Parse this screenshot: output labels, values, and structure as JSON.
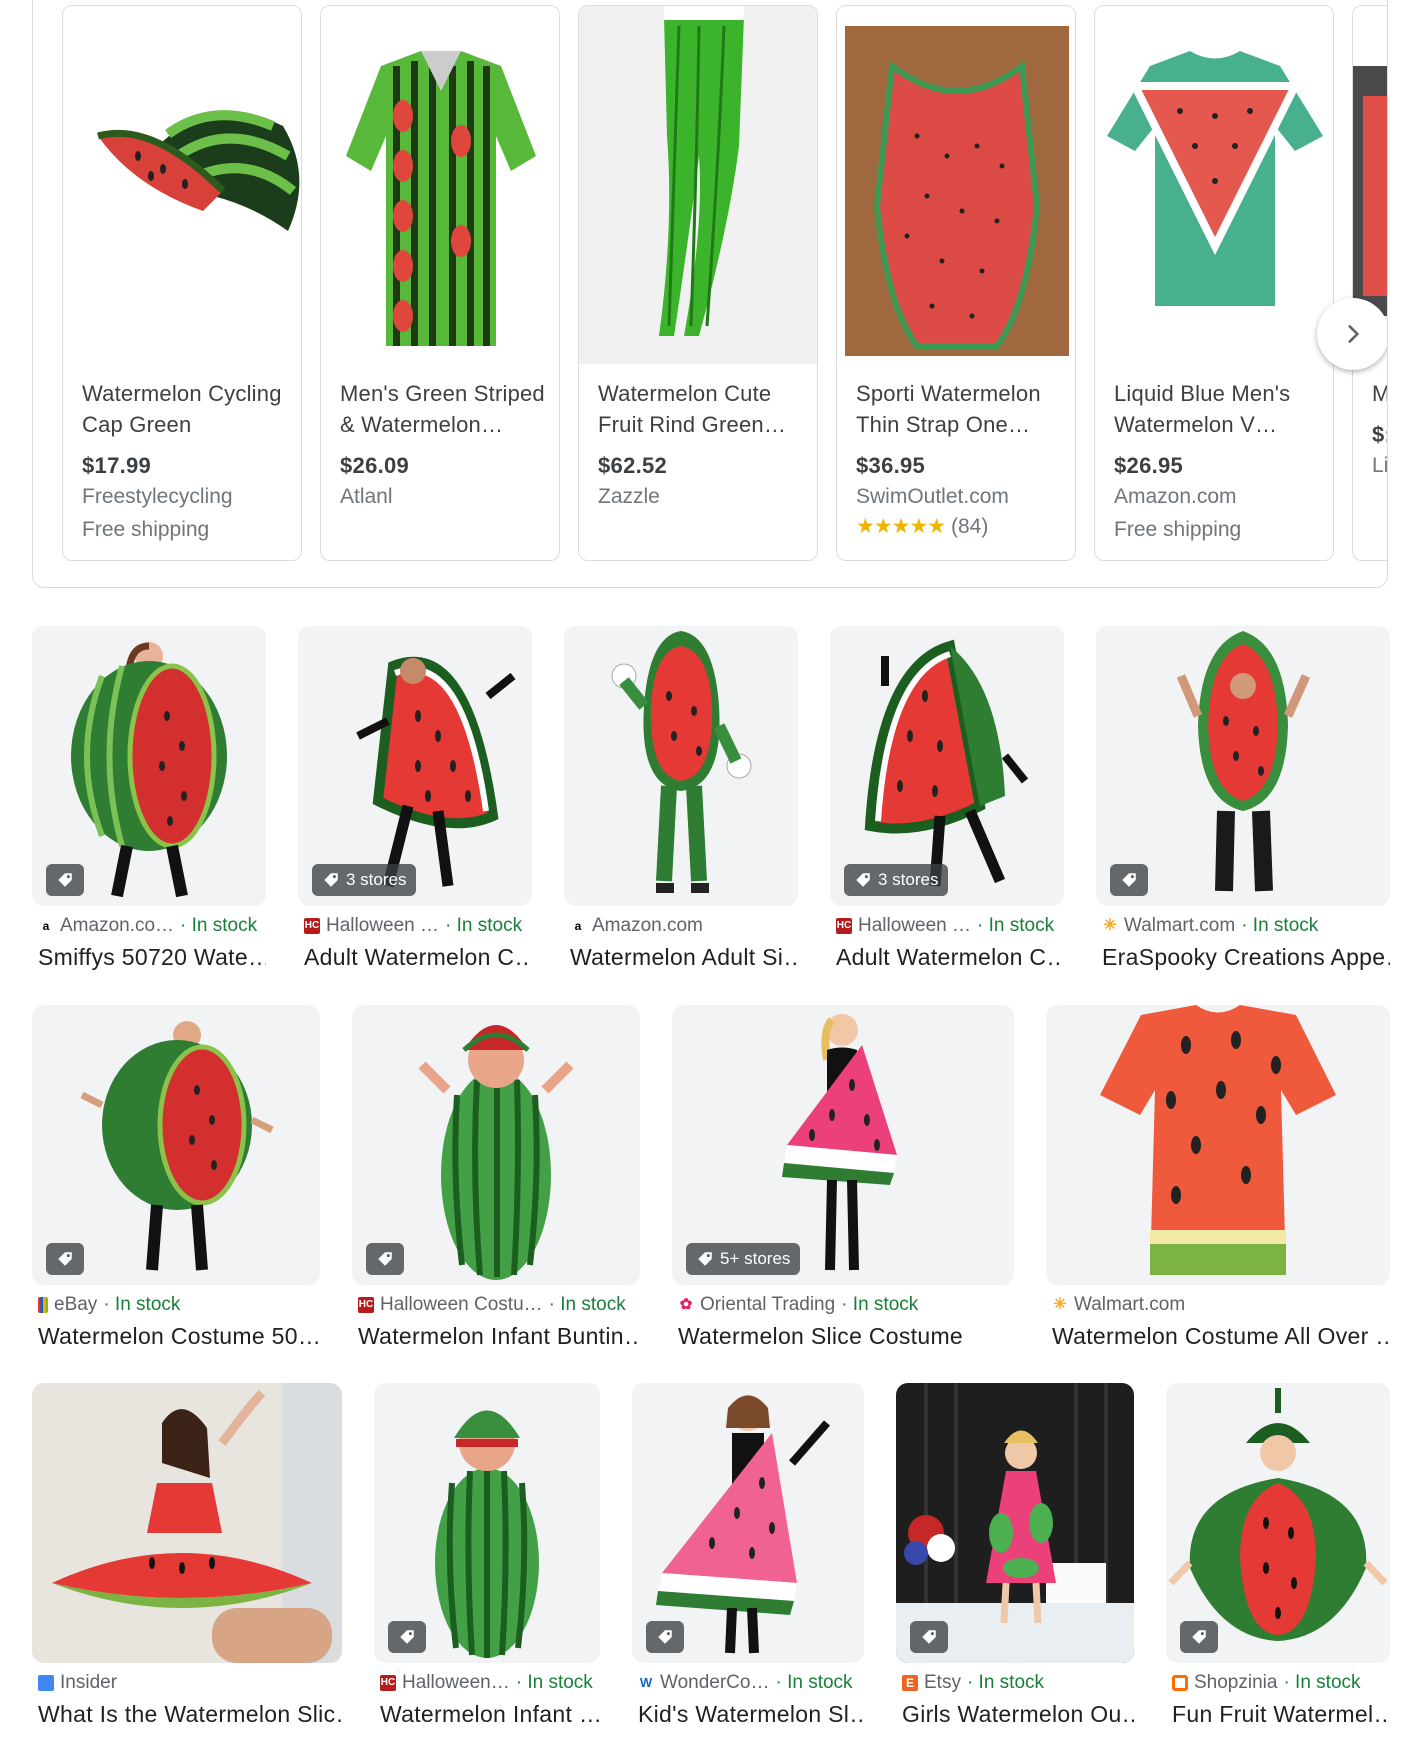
{
  "carousel": {
    "next_label": "Next",
    "items": [
      {
        "title": "Watermelon Cycling Cap Green",
        "price": "$17.99",
        "store": "Freestylecycling",
        "shipping": "Free shipping"
      },
      {
        "title": "Men's Green Striped & Watermelon…",
        "price": "$26.09",
        "store": "Atlanl"
      },
      {
        "title": "Watermelon Cute Fruit Rind Green…",
        "price": "$62.52",
        "store": "Zazzle"
      },
      {
        "title": "Sporti Watermelon Thin Strap One…",
        "price": "$36.95",
        "store": "SwimOutlet.com",
        "stars": "★★★★★",
        "reviews": "(84)"
      },
      {
        "title": "Liquid Blue Men's Watermelon V…",
        "price": "$26.95",
        "store": "Amazon.com",
        "shipping": "Free shipping"
      },
      {
        "title": "M Sl",
        "price": "$:",
        "store": "Li"
      }
    ]
  },
  "grid": {
    "row1": [
      {
        "source": "Amazon.co…",
        "stock": "· In stock",
        "title": "Smiffys 50720 Wate…",
        "badge": ""
      },
      {
        "source": "Halloween …",
        "stock": "· In stock",
        "title": "Adult Watermelon C…",
        "badge": "3 stores"
      },
      {
        "source": "Amazon.com",
        "stock": "",
        "title": "Watermelon Adult Si…",
        "badge": null
      },
      {
        "source": "Halloween …",
        "stock": "· In stock",
        "title": "Adult Watermelon C…",
        "badge": "3 stores"
      },
      {
        "source": "Walmart.com",
        "stock": "· In stock",
        "title": "EraSpooky Creations Appe…",
        "badge": ""
      }
    ],
    "row2": [
      {
        "source": "eBay",
        "stock": "· In stock",
        "title": "Watermelon Costume 50…",
        "badge": ""
      },
      {
        "source": "Halloween Costu…",
        "stock": "· In stock",
        "title": "Watermelon Infant Buntin…",
        "badge": ""
      },
      {
        "source": "Oriental Trading",
        "stock": "· In stock",
        "title": "Watermelon Slice Costume",
        "badge": "5+ stores"
      },
      {
        "source": "Walmart.com",
        "stock": "",
        "title": "Watermelon Costume All Over …",
        "badge": null
      }
    ],
    "row3": [
      {
        "source": "Insider",
        "stock": "",
        "title": "What Is the Watermelon Slic…",
        "badge": null
      },
      {
        "source": "Halloween…",
        "stock": "· In stock",
        "title": "Watermelon Infant …",
        "badge": ""
      },
      {
        "source": "WonderCo…",
        "stock": "· In stock",
        "title": "Kid's Watermelon Sl…",
        "badge": ""
      },
      {
        "source": "Etsy",
        "stock": "· In stock",
        "title": "Girls Watermelon Ou…",
        "badge": ""
      },
      {
        "source": "Shopzinia",
        "stock": "· In stock",
        "title": "Fun Fruit Watermel…",
        "badge": ""
      }
    ]
  }
}
